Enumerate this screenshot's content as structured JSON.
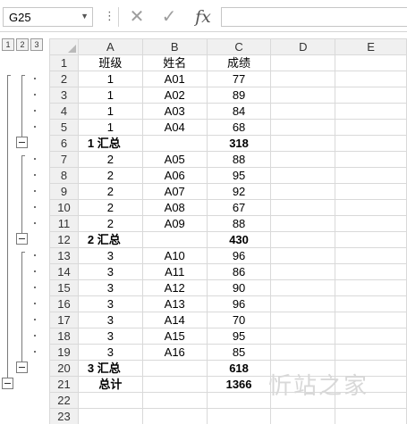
{
  "formula_bar": {
    "name_box": "G25",
    "name_box_arrow": "▼",
    "dots": "⋮",
    "cancel_glyph": "✕",
    "enter_glyph": "✓",
    "fx": "fx",
    "formula": ""
  },
  "outline_levels": [
    "1",
    "2",
    "3"
  ],
  "columns": [
    "A",
    "B",
    "C",
    "D",
    "E"
  ],
  "rows": [
    {
      "num": "1",
      "A": "班级",
      "B": "姓名",
      "C": "成绩",
      "type": "header"
    },
    {
      "num": "2",
      "A": "1",
      "B": "A01",
      "C": "77",
      "type": "data"
    },
    {
      "num": "3",
      "A": "1",
      "B": "A02",
      "C": "89",
      "type": "data"
    },
    {
      "num": "4",
      "A": "1",
      "B": "A03",
      "C": "84",
      "type": "data"
    },
    {
      "num": "5",
      "A": "1",
      "B": "A04",
      "C": "68",
      "type": "data"
    },
    {
      "num": "6",
      "A": "1  汇总",
      "B": "",
      "C": "318",
      "type": "subtotal"
    },
    {
      "num": "7",
      "A": "2",
      "B": "A05",
      "C": "88",
      "type": "data"
    },
    {
      "num": "8",
      "A": "2",
      "B": "A06",
      "C": "95",
      "type": "data"
    },
    {
      "num": "9",
      "A": "2",
      "B": "A07",
      "C": "92",
      "type": "data"
    },
    {
      "num": "10",
      "A": "2",
      "B": "A08",
      "C": "67",
      "type": "data"
    },
    {
      "num": "11",
      "A": "2",
      "B": "A09",
      "C": "88",
      "type": "data"
    },
    {
      "num": "12",
      "A": "2  汇总",
      "B": "",
      "C": "430",
      "type": "subtotal"
    },
    {
      "num": "13",
      "A": "3",
      "B": "A10",
      "C": "96",
      "type": "data"
    },
    {
      "num": "14",
      "A": "3",
      "B": "A11",
      "C": "86",
      "type": "data"
    },
    {
      "num": "15",
      "A": "3",
      "B": "A12",
      "C": "90",
      "type": "data"
    },
    {
      "num": "16",
      "A": "3",
      "B": "A13",
      "C": "96",
      "type": "data"
    },
    {
      "num": "17",
      "A": "3",
      "B": "A14",
      "C": "70",
      "type": "data"
    },
    {
      "num": "18",
      "A": "3",
      "B": "A15",
      "C": "95",
      "type": "data"
    },
    {
      "num": "19",
      "A": "3",
      "B": "A16",
      "C": "85",
      "type": "data"
    },
    {
      "num": "20",
      "A": "3  汇总",
      "B": "",
      "C": "618",
      "type": "subtotal"
    },
    {
      "num": "21",
      "A": "总计",
      "B": "",
      "C": "1366",
      "type": "grandtotal"
    },
    {
      "num": "22",
      "A": "",
      "B": "",
      "C": "",
      "type": "empty"
    },
    {
      "num": "23",
      "A": "",
      "B": "",
      "C": "",
      "type": "empty"
    }
  ],
  "watermark": "忻站之家"
}
